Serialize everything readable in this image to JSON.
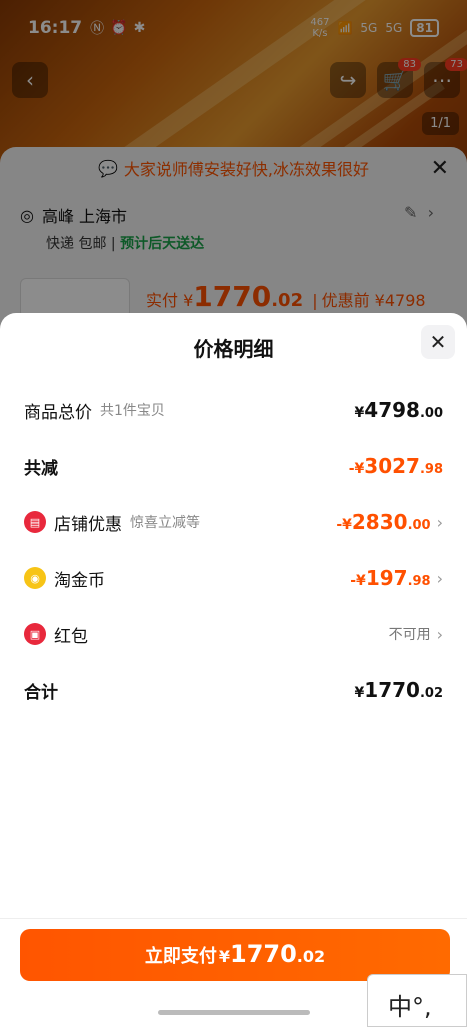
{
  "status_bar": {
    "time": "16:17",
    "net_speed_value": "467",
    "net_speed_unit": "K/s",
    "signal1": "5G",
    "signal2": "5G",
    "battery": "81"
  },
  "background": {
    "cart_badge": "83",
    "more_badge": "73",
    "pager": "1/1",
    "tip": "大家说师傅安装好快,冰冻效果很好",
    "address_name": "高峰 上海市",
    "shipping_prefix": "快递 包邮 | ",
    "shipping_eta": "预计后天送达",
    "actual_label": "实付 ¥",
    "actual_int": "1770",
    "actual_dec": ".02",
    "before_discount": "优惠前 ¥4798"
  },
  "sheet": {
    "title": "价格明细",
    "rows": [
      {
        "label": "商品总价",
        "sub": "共1件宝贝",
        "cur": "¥",
        "int": "4798",
        "dec": ".00"
      },
      {
        "label": "共减",
        "cur": "-¥",
        "int": "3027",
        "dec": ".98"
      },
      {
        "label": "店铺优惠",
        "sub": "惊喜立减等",
        "cur": "-¥",
        "int": "2830",
        "dec": ".00"
      },
      {
        "label": "淘金币",
        "cur": "-¥",
        "int": "197",
        "dec": ".98"
      },
      {
        "label": "红包",
        "status": "不可用"
      },
      {
        "label": "合计",
        "cur": "¥",
        "int": "1770",
        "dec": ".02"
      }
    ]
  },
  "pay_button": {
    "label": "立即支付",
    "cur": "¥",
    "int": "1770",
    "dec": ".02"
  },
  "ime_text": "中°,"
}
